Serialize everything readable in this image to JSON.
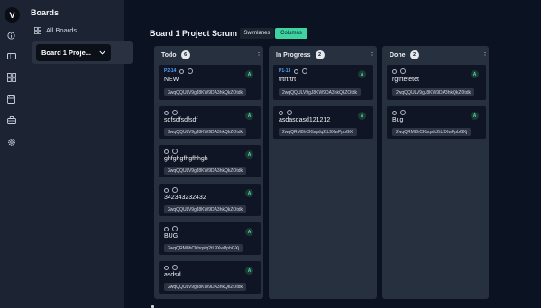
{
  "user": {
    "initial": "V"
  },
  "rail_icons": [
    "info-icon",
    "ticket-icon",
    "boards-icon",
    "calendar-icon",
    "briefcase-icon",
    "settings-icon"
  ],
  "panel": {
    "title": "Boards",
    "all_boards_label": "All Boards",
    "selected_board": "Board 1 Proje..."
  },
  "header": {
    "board_title": "Board 1 Project Scrum",
    "view_swimlanes": "Swimlanes",
    "view_columns": "Columns"
  },
  "colors": {
    "accent": "#3ed4a2",
    "ticket_id": "#4fa3ff",
    "panel_bg": "#1c2433",
    "page_bg": "#0b1222"
  },
  "columns": [
    {
      "name": "Todo",
      "count": "6",
      "cards": [
        {
          "id": "P2-14",
          "title": "NEW",
          "chip": "2wqQQULV9gJ8KW9DA3hkQkZOtdk",
          "assignee": "A"
        },
        {
          "id": "",
          "title": "sdfsdfsdfsdf",
          "chip": "2wqQQULV9gJ8KW9DA3hkQkZOtdk",
          "assignee": "A"
        },
        {
          "id": "",
          "title": "ghfghgfhgfhhgh",
          "chip": "2wqQQULV9gJ8KW9DA3hkQkZOtdk",
          "assignee": "A"
        },
        {
          "id": "",
          "title": "342343232432",
          "chip": "2wqQQULV9gJ8KW9DA3hkQkZOtdk",
          "assignee": "A"
        },
        {
          "id": "",
          "title": "BUG",
          "chip": "2wqQRM8hCKbqxlq2tL9XwPpbGXj",
          "assignee": "A"
        },
        {
          "id": "",
          "title": "asdsd",
          "chip": "2wqQQULV9gJ8KW9DA3hkQkZOtdk",
          "assignee": "A"
        }
      ]
    },
    {
      "name": "In Progress",
      "count": "2",
      "cards": [
        {
          "id": "P1-13",
          "title": "trtrtrtrt",
          "chip": "2wqQQULV9gJ8KW9DA3hkQkZOtdk",
          "assignee": "A"
        },
        {
          "id": "",
          "title": "asdasdasd121212",
          "chip": "2wqQRM8hCKbqxlq2tL9XwPpbGXj",
          "assignee": "A"
        }
      ]
    },
    {
      "name": "Done",
      "count": "2",
      "cards": [
        {
          "id": "",
          "title": "rgtrtetetet",
          "chip": "2wqQQULV9gJ8KW9DA3hkQkZOtdk",
          "assignee": "A"
        },
        {
          "id": "",
          "title": "Bug",
          "chip": "2wqQRM8hCKbqxlq2tL9XwPpbGXj",
          "assignee": "A"
        }
      ]
    }
  ]
}
